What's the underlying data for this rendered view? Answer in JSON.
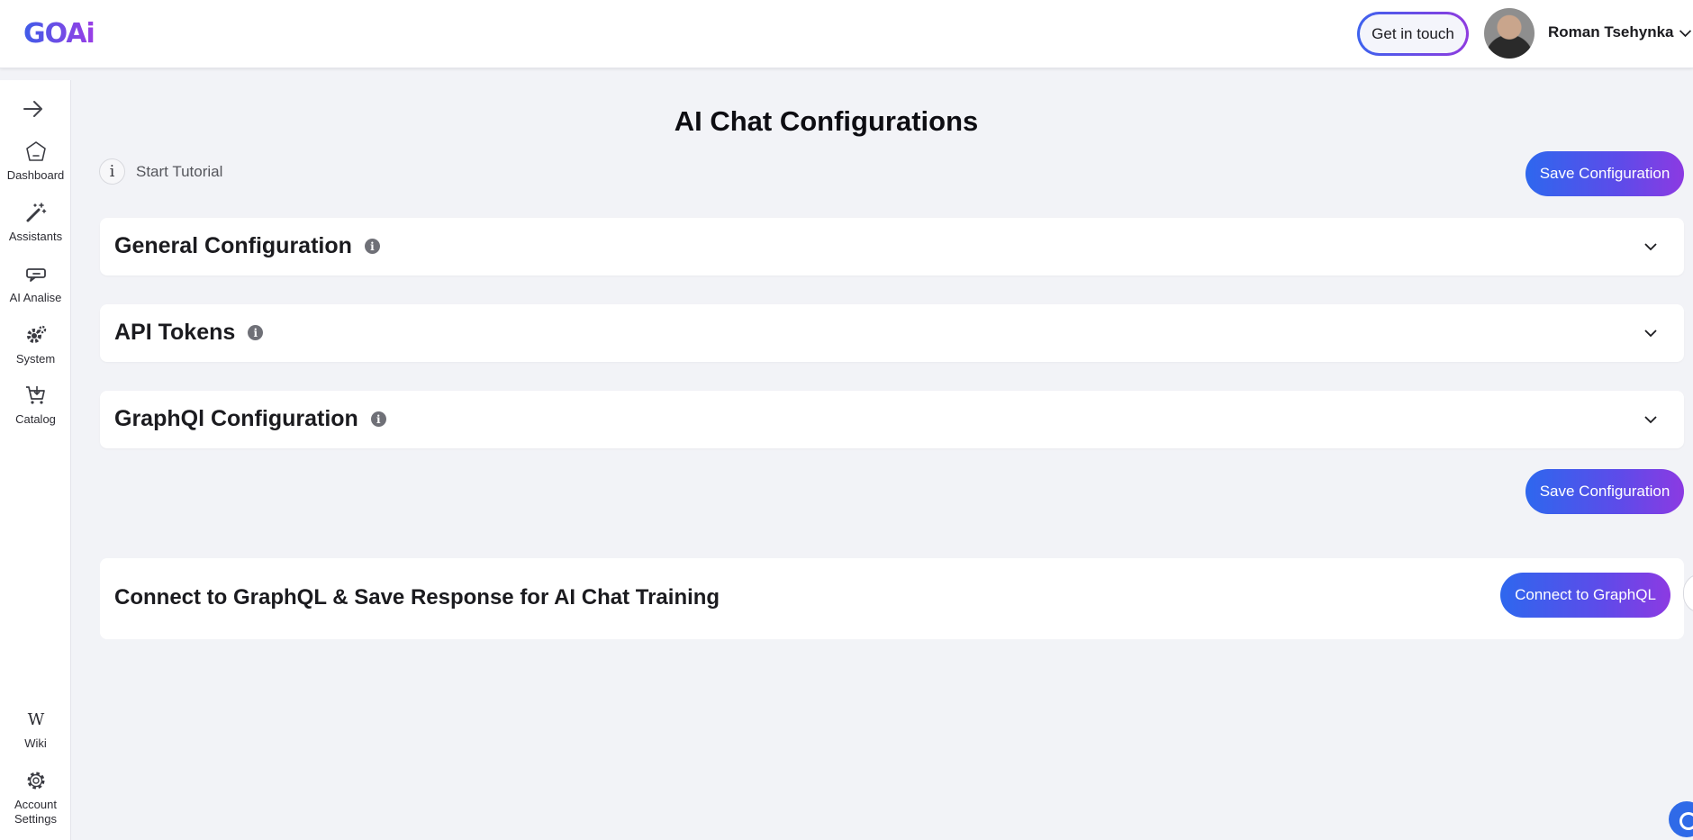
{
  "header": {
    "logo": "GOAi",
    "get_in_touch": "Get in touch",
    "user_name": "Roman Tsehynka"
  },
  "sidebar": {
    "items": [
      {
        "label": "Dashboard",
        "icon": "home-icon"
      },
      {
        "label": "Assistants",
        "icon": "magic-wand-icon"
      },
      {
        "label": "AI Analise",
        "icon": "chat-analytics-icon"
      },
      {
        "label": "System",
        "icon": "gears-icon"
      },
      {
        "label": "Catalog",
        "icon": "cart-icon"
      }
    ],
    "bottom_items": [
      {
        "label": "Wiki",
        "icon": "wikipedia-icon"
      },
      {
        "label": "Account Settings",
        "icon": "gear-icon"
      }
    ]
  },
  "main": {
    "title": "AI Chat Configurations",
    "start_tutorial": "Start Tutorial",
    "save_label": "Save Configuration",
    "panels": [
      {
        "title": "General Configuration"
      },
      {
        "title": "API Tokens"
      },
      {
        "title": "GraphQl Configuration"
      }
    ],
    "graphql_card": {
      "title": "Connect to GraphQL & Save Response for AI Chat Training",
      "button": "Connect to GraphQL"
    }
  },
  "colors": {
    "accent_start": "#2e67ee",
    "accent_end": "#8c3ae2",
    "background": "#f2f3f7"
  }
}
